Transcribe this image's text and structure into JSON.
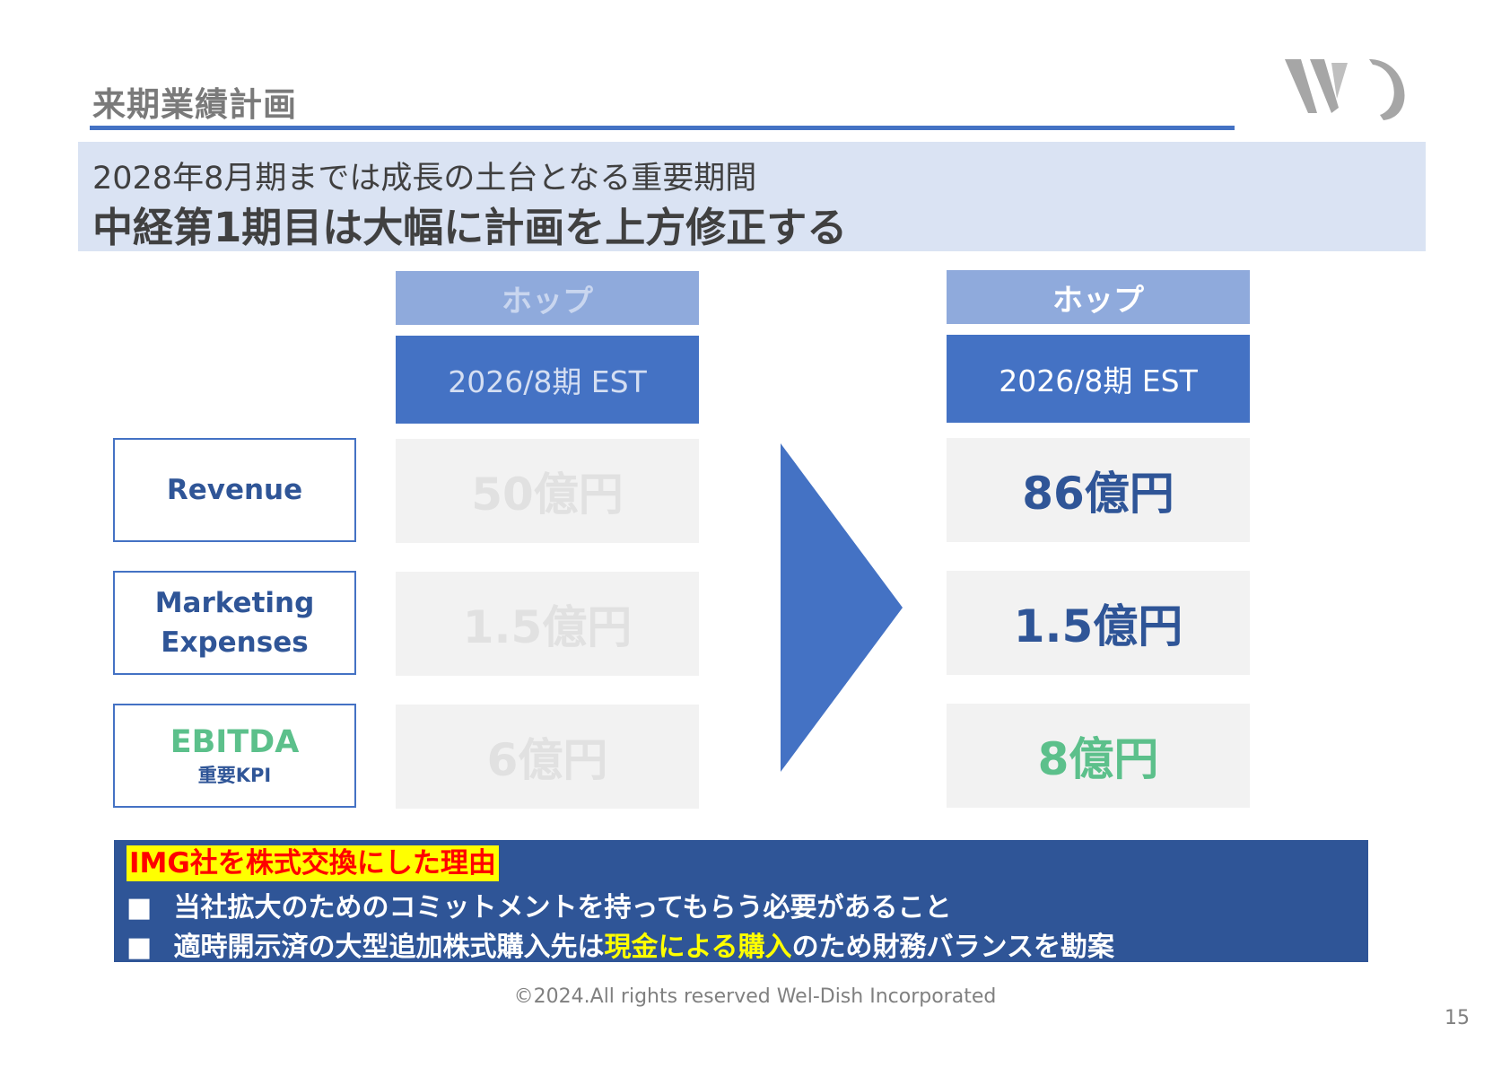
{
  "title": "来期業績計画",
  "banner": {
    "subtitle": "2028年8月期までは成長の土台となる重要期間",
    "headline": "中経第1期目は大幅に計画を上方修正する"
  },
  "columns": [
    {
      "phase": "ホップ",
      "period": "2026/8期 EST"
    },
    {
      "phase": "ホップ",
      "period": "2026/8期 EST"
    }
  ],
  "rows": [
    {
      "label_lines": [
        "Revenue"
      ],
      "old": "50億円",
      "new": "86億円"
    },
    {
      "label_lines": [
        "Marketing",
        "Expenses"
      ],
      "old": "1.5億円",
      "new": "1.5億円"
    },
    {
      "label": "EBITDA",
      "sublabel": "重要KPI",
      "old": "6億円",
      "new": "8億円"
    }
  ],
  "reason": {
    "heading": "IMG社を株式交換にした理由",
    "bullet_marker": "■",
    "bullets": [
      {
        "text": "当社拡大のためのコミットメントを持ってもらう必要があること"
      },
      {
        "before": "適時開示済の大型追加株式購入先は",
        "highlight": "現金による購入",
        "after": "のため財務バランスを勘案"
      }
    ]
  },
  "footer": "©2024.All rights reserved Wel-Dish Incorporated",
  "page_number": "15",
  "logo_text": "WD",
  "colors": {
    "accent_blue": "#4472c4",
    "dark_blue": "#2f5597",
    "light_blue": "#8faadc",
    "banner_bg": "#dae3f3",
    "green": "#5cc08b",
    "highlight_yellow": "#ffff00",
    "highlight_red": "#ff0000"
  }
}
